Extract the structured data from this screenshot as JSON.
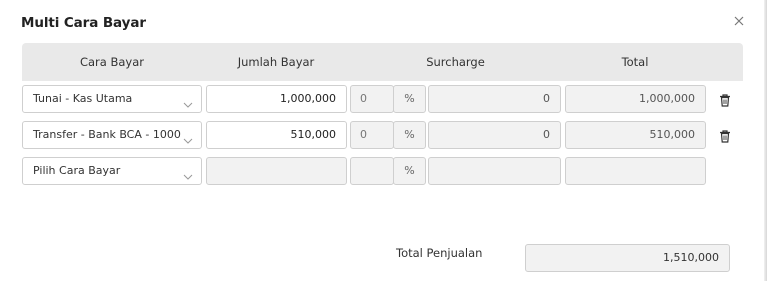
{
  "dialog": {
    "title": "Multi Cara Bayar",
    "close_icon": "close-icon"
  },
  "table": {
    "headers": {
      "method": "Cara Bayar",
      "amount": "Jumlah Bayar",
      "surcharge": "Surcharge",
      "total": "Total"
    },
    "rows": [
      {
        "method": "Tunai - Kas Utama",
        "amount": "1,000,000",
        "surcharge_percent": "0",
        "percent_symbol": "%",
        "surcharge_amount": "0",
        "total": "1,000,000"
      },
      {
        "method": "Transfer - Bank BCA - 1000",
        "amount": "510,000",
        "surcharge_percent": "0",
        "percent_symbol": "%",
        "surcharge_amount": "0",
        "total": "510,000"
      },
      {
        "method": "Pilih Cara Bayar",
        "amount": "",
        "surcharge_percent": "",
        "percent_symbol": "%",
        "surcharge_amount": "",
        "total": ""
      }
    ]
  },
  "footer": {
    "total_label": "Total Penjualan",
    "total_value": "1,510,000"
  },
  "icons": {
    "dropdown": "chevron-down-icon",
    "delete": "trash-icon"
  }
}
